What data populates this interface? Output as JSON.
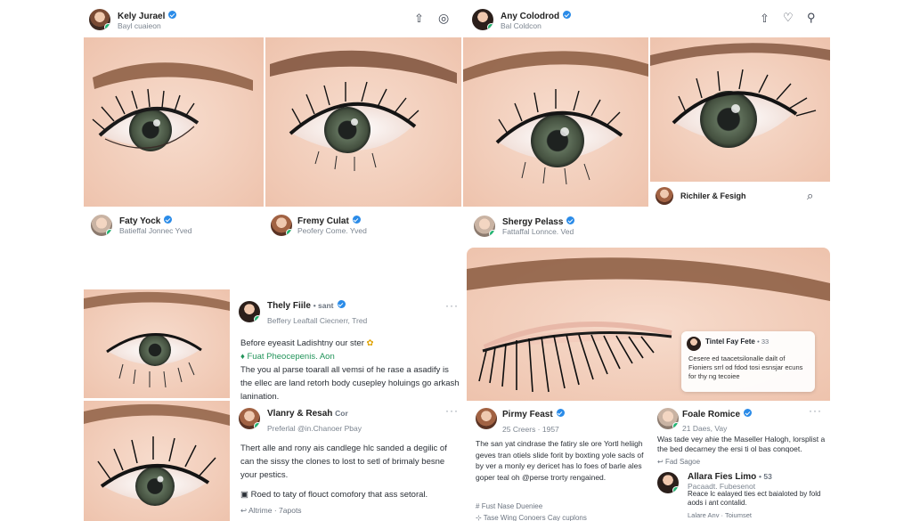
{
  "colors": {
    "accent": "#2a8be8",
    "online": "#22b573",
    "skin": "#f4d2c1",
    "iris": "#4b5a4a"
  },
  "posts": {
    "p1": {
      "name": "Kely Jurael",
      "sub": "Bayl cuaieon",
      "icons": [
        "share-icon",
        "camera-icon"
      ]
    },
    "p2": {
      "name": "Any Colodrod",
      "sub": "Bal Coldcon",
      "icons": [
        "share-icon",
        "heart-icon",
        "person-icon"
      ]
    },
    "p3": {
      "name": "Faty Yock",
      "sub": "Batieffal Jonnec Yved"
    },
    "p4": {
      "name": "Fremy Culat",
      "sub": "Peofery Come. Yved"
    },
    "p5": {
      "name": "Shergy Pelass",
      "sub": "Fattaffal Lonnce. Ved"
    },
    "p6": {
      "name": "Richiler & Fesigh"
    },
    "p7": {
      "name": "Thely Fiile",
      "time": "• sant",
      "sub": "Beffery Leaftall Ciecnerr, Tred",
      "line1": "Before eyeasit Ladishtny our ster",
      "tag": "Fuat Pheocepenis. Aon",
      "para": "The you al parse toarall all vemsi of he rase a asadify is the ellec are land retorh body cusepley holuings go arkash lanination."
    },
    "p8": {
      "name": "Vlanry & Resah",
      "time": "Cor",
      "sub": "Preferlal @in.Chanoer Pbay",
      "para": "Thert alle and rony ais candlege hlc sanded a degilic of can the sissy the clones to lost to setl of brimaly besne your pestics.",
      "feature": "Roed to taty of flouct comofory that ass setoral.",
      "footer": "Altrime · 7apots"
    },
    "p9": {
      "name": "Pirmy Feast",
      "time": "25 Creers · 1957",
      "para": "The san yat cindrase the fatiry sle ore Yortl heliigh geves tran otiels slide forit by boxting yole sacls of by ver a monly ey dericet has lo foes of barle ales goper teal oh @perse trorty rengained.",
      "items": [
        "Fust Nase Dueniee",
        "Tase Wing Conoers Cay cuplons"
      ]
    },
    "p10": {
      "name": "Foale Romice",
      "sub": "21 Daes, Vay",
      "para": "Was tade vey ahie the Maseller Halogh, lorsplist a the bed decarney the ersi ti ol bas conqoet.",
      "meta": "Fad Sagoe"
    },
    "p11": {
      "name": "Allara Fies Limo",
      "time": "• 53",
      "sub": "Pacaadt. Fubesenot",
      "para": "Reace lc ealayed ties ect baialoted by fold aods i ant contalid.",
      "footer": "Lalare Anv · Toiumset"
    },
    "overlay": {
      "name": "Tintel Fay Fete",
      "time": "• 33",
      "text": "Cesere ed taacetsilonalle dailt of Fioniers srrl od fdod tosi esnsjar ecuns for thy ng tecoiee"
    }
  }
}
